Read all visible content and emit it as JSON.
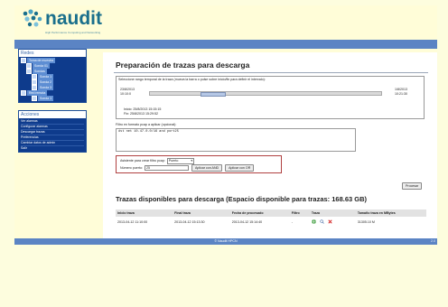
{
  "brand": {
    "name": "naudit",
    "tagline": "High Performance Computing and Networking"
  },
  "sidebar": {
    "redes_title": "Redes",
    "tree": [
      {
        "label": "Toma de muestra"
      },
      {
        "label": "Sonda 01"
      },
      {
        "label": "Sondas"
      },
      {
        "label": "Sonda 1"
      },
      {
        "label": "Sonda 2"
      },
      {
        "label": "Sonda 3"
      },
      {
        "label": "Red remota"
      },
      {
        "label": "Sonda 1"
      }
    ],
    "acciones_title": "Acciones",
    "menu": [
      {
        "label": "Ver alarmas"
      },
      {
        "label": "Configurar alarmas"
      },
      {
        "label": "Descargar trazas"
      },
      {
        "label": "Preferencias"
      },
      {
        "label": "Cambiar datos de admin"
      },
      {
        "label": "Salir"
      }
    ]
  },
  "main": {
    "title": "Preparación de trazas para descarga",
    "range": {
      "title": "Seleccione rango temporal de la traza (mueva la barra o pulse sobre inicio/fin para definir el intervalo):",
      "start_date": "23/8/2013",
      "start_time": "10:10:0",
      "end_date": "1/8/2013",
      "end_time": "10:21:30",
      "selection_start_pct": 22,
      "selection_end_pct": 32,
      "inicio_label": "Inicio:",
      "inicio_value": "25/8/2013 15:15:15",
      "fin_label": "Fin:",
      "fin_value": "25/8/2013 15:29:52"
    },
    "filter": {
      "label": "Filtro en formato pcap a aplicar (opcional):",
      "value": "dst net 10.47.0.0/16 and port25"
    },
    "assistant": {
      "label": "Asistente para crear filtro pcap:",
      "select_value": "Puerto",
      "number_label": "Número puerto:",
      "number_value": "25",
      "btn_and": "Aplicar con AND",
      "btn_or": "Aplicar con OR"
    },
    "procesar_label": "Procesar",
    "downloads": {
      "title": "Trazas disponibles para descarga (Espacio disponible para trazas: 168.63 GB)",
      "headers": [
        "Inicio traza",
        "Final traza",
        "Fecha de procesado",
        "Filtro",
        "Traza",
        "Tamaño traza en MBytes"
      ],
      "rows": [
        {
          "inicio": "2013-04-12 11:10:00",
          "final": "2013-04-12 15:13:30",
          "procesado": "2013-04-12 15:14:40",
          "filtro": "-",
          "size": "31305.10 M"
        }
      ]
    }
  },
  "footer": {
    "text": "© Naudit HPCN",
    "version": "2.0"
  },
  "colors": {
    "accent": "#5b84c4",
    "nav_dark": "#0e3b8c",
    "logo": "#1a6f8c"
  }
}
